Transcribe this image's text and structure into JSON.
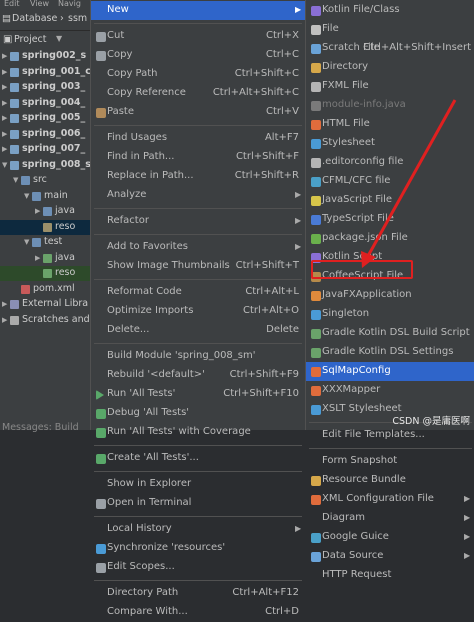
{
  "topbar": {
    "items": [
      "Edit",
      "View",
      "Navig"
    ]
  },
  "tabs": {
    "database": "Database",
    "second": "ssm"
  },
  "project_header": {
    "label": "Project"
  },
  "tree": {
    "items": [
      {
        "label": "spring002_s",
        "bold": true
      },
      {
        "label": "spring_001_c",
        "bold": true
      },
      {
        "label": "spring_003_",
        "bold": true
      },
      {
        "label": "spring_004_",
        "bold": true
      },
      {
        "label": "spring_005_",
        "bold": true
      },
      {
        "label": "spring_006_",
        "bold": true
      },
      {
        "label": "spring_007_",
        "bold": true
      },
      {
        "label": "spring_008_s",
        "bold": true
      },
      {
        "label": "src",
        "bold": false
      },
      {
        "label": "main",
        "bold": false
      },
      {
        "label": "java",
        "bold": false
      },
      {
        "label": "reso",
        "bold": false
      },
      {
        "label": "test",
        "bold": false
      },
      {
        "label": "java",
        "bold": false
      },
      {
        "label": "reso",
        "bold": false
      },
      {
        "label": "pom.xml",
        "bold": false
      },
      {
        "label": "External Libra",
        "bold": false
      },
      {
        "label": "Scratches and",
        "bold": false
      }
    ],
    "bottom": "Messages:   Build"
  },
  "context_menu": {
    "items": [
      {
        "label": "New",
        "shortcut": "",
        "submenu": true,
        "highlight": true
      },
      {
        "sep": true
      },
      {
        "label": "Cut",
        "shortcut": "Ctrl+X",
        "icon": "scissors-icon"
      },
      {
        "label": "Copy",
        "shortcut": "Ctrl+C",
        "icon": "copy-icon"
      },
      {
        "label": "Copy Path",
        "shortcut": "Ctrl+Shift+C"
      },
      {
        "label": "Copy Reference",
        "shortcut": "Ctrl+Alt+Shift+C"
      },
      {
        "label": "Paste",
        "shortcut": "Ctrl+V",
        "icon": "paste-icon"
      },
      {
        "sep": true
      },
      {
        "label": "Find Usages",
        "shortcut": "Alt+F7"
      },
      {
        "label": "Find in Path...",
        "shortcut": "Ctrl+Shift+F"
      },
      {
        "label": "Replace in Path...",
        "shortcut": "Ctrl+Shift+R"
      },
      {
        "label": "Analyze",
        "submenu": true
      },
      {
        "sep": true
      },
      {
        "label": "Refactor",
        "submenu": true
      },
      {
        "sep": true
      },
      {
        "label": "Add to Favorites",
        "submenu": true
      },
      {
        "label": "Show Image Thumbnails",
        "shortcut": "Ctrl+Shift+T"
      },
      {
        "sep": true
      },
      {
        "label": "Reformat Code",
        "shortcut": "Ctrl+Alt+L"
      },
      {
        "label": "Optimize Imports",
        "shortcut": "Ctrl+Alt+O"
      },
      {
        "label": "Delete...",
        "shortcut": "Delete"
      },
      {
        "sep": true
      },
      {
        "label": "Build Module 'spring_008_sm'",
        "shortcut": ""
      },
      {
        "label": "Rebuild '<default>'",
        "shortcut": "Ctrl+Shift+F9"
      },
      {
        "label": "Run 'All Tests'",
        "shortcut": "Ctrl+Shift+F10",
        "icon": "run-icon"
      },
      {
        "label": "Debug 'All Tests'",
        "shortcut": "",
        "icon": "debug-icon"
      },
      {
        "label": "Run 'All Tests' with Coverage",
        "shortcut": "",
        "icon": "coverage-icon"
      },
      {
        "sep": true
      },
      {
        "label": "Create 'All Tests'...",
        "shortcut": "",
        "icon": "create-test-icon"
      },
      {
        "sep": true
      },
      {
        "label": "Show in Explorer",
        "shortcut": ""
      },
      {
        "label": "Open in Terminal",
        "shortcut": "",
        "icon": "terminal-icon"
      },
      {
        "sep": true
      },
      {
        "label": "Local History",
        "submenu": true
      },
      {
        "label": "Synchronize 'resources'",
        "shortcut": "",
        "icon": "sync-icon"
      },
      {
        "label": "Edit Scopes...",
        "shortcut": "",
        "icon": "scope-icon"
      },
      {
        "sep": true
      },
      {
        "label": "Directory Path",
        "shortcut": "Ctrl+Alt+F12"
      },
      {
        "label": "Compare With...",
        "shortcut": "Ctrl+D"
      }
    ]
  },
  "new_submenu": {
    "items": [
      {
        "label": "Kotlin File/Class",
        "color": "#8a6fd6"
      },
      {
        "label": "File",
        "color": "#c0c0c0"
      },
      {
        "label": "Scratch File",
        "shortcut": "Ctrl+Alt+Shift+Insert",
        "color": "#6aa3d8"
      },
      {
        "label": "Directory",
        "color": "#d6a84a"
      },
      {
        "label": "FXML File",
        "color": "#b5b5b5"
      },
      {
        "label": "module-info.java",
        "color": "#7a7a7a",
        "disabled": true
      },
      {
        "label": "HTML File",
        "color": "#e06c3c"
      },
      {
        "label": "Stylesheet",
        "color": "#4a9bd6"
      },
      {
        "label": ".editorconfig file",
        "color": "#b5b5b5"
      },
      {
        "label": "CFML/CFC file",
        "color": "#4aa0c8"
      },
      {
        "label": "JavaScript File",
        "color": "#d6c54a"
      },
      {
        "label": "TypeScript File",
        "color": "#4a7bd6"
      },
      {
        "label": "package.json File",
        "color": "#6ab04c"
      },
      {
        "label": "Kotlin Script",
        "color": "#8a6fd6"
      },
      {
        "label": "CoffeeScript File",
        "color": "#b58a4a"
      },
      {
        "label": "JavaFXApplication",
        "color": "#e08a3c"
      },
      {
        "label": "Singleton",
        "color": "#4a9bd6"
      },
      {
        "label": "Gradle Kotlin DSL Build Script",
        "color": "#6aa36a"
      },
      {
        "label": "Gradle Kotlin DSL Settings",
        "color": "#6aa36a"
      },
      {
        "label": "SqlMapConfig",
        "color": "#e06c3c",
        "highlight": true
      },
      {
        "label": "XXXMapper",
        "color": "#e06c3c"
      },
      {
        "label": "XSLT Stylesheet",
        "color": "#4a9bd6"
      },
      {
        "sep": true
      },
      {
        "label": "Edit File Templates...",
        "color": ""
      },
      {
        "sep": true
      },
      {
        "label": "Form Snapshot",
        "color": ""
      },
      {
        "label": "Resource Bundle",
        "color": "#d6a84a"
      },
      {
        "label": "XML Configuration File",
        "color": "#e06c3c",
        "submenu": true
      },
      {
        "label": "Diagram",
        "color": "",
        "submenu": true
      },
      {
        "label": "Google Guice",
        "color": "#4aa0c8",
        "submenu": true
      },
      {
        "label": "Data Source",
        "color": "#6aa3d8",
        "submenu": true
      },
      {
        "label": "HTTP Request",
        "color": ""
      }
    ]
  },
  "watermark": "CSDN @是庸医啊",
  "colors": {
    "highlight": "#2f65ca",
    "annotation": "#e02020"
  }
}
